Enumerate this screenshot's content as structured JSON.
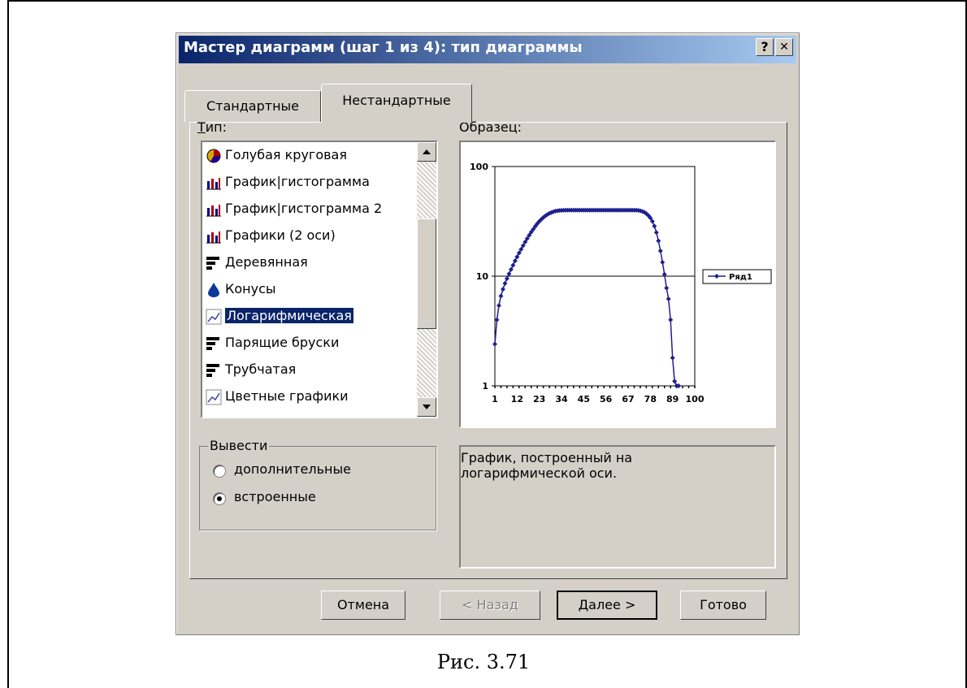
{
  "dialog": {
    "title": "Мастер диаграмм (шаг 1 из 4): тип диаграммы",
    "help_button": "?",
    "close_button": "✕",
    "tabs": [
      {
        "label": "Стандартные",
        "active": false
      },
      {
        "label": "Нестандартные",
        "active": true
      }
    ],
    "type_label": "Тип:",
    "sample_label": "Образец:",
    "chart_types": [
      {
        "label": "Голубая круговая",
        "icon": "pie-icon"
      },
      {
        "label": "График|гистограмма",
        "icon": "line-column-icon"
      },
      {
        "label": "График|гистограмма 2",
        "icon": "line-column-icon"
      },
      {
        "label": "Графики (2 оси)",
        "icon": "line-column-icon"
      },
      {
        "label": "Деревянная",
        "icon": "bar-icon"
      },
      {
        "label": "Конусы",
        "icon": "cone-icon"
      },
      {
        "label": "Логарифмическая",
        "icon": "log-line-icon",
        "selected": true
      },
      {
        "label": "Парящие бруски",
        "icon": "bar-icon"
      },
      {
        "label": "Трубчатая",
        "icon": "bar-icon"
      },
      {
        "label": "Цветные графики",
        "icon": "log-line-icon"
      }
    ],
    "output_group": {
      "title": "Вывести",
      "options": [
        {
          "label": "дополнительные",
          "checked": false
        },
        {
          "label": "встроенные",
          "checked": true
        }
      ]
    },
    "description": [
      "График, построенный на",
      "логарифмической оси."
    ],
    "buttons": {
      "cancel": "Отмена",
      "back": "< Назад",
      "next": "Далее >",
      "finish": "Готово"
    }
  },
  "caption": "Рис. 3.71",
  "chart_data": {
    "type": "line",
    "yscale": "log",
    "ylim": [
      1,
      100
    ],
    "y_ticks": [
      "1",
      "10",
      "100"
    ],
    "x_ticks": [
      "1",
      "12",
      "23",
      "34",
      "45",
      "56",
      "67",
      "78",
      "89",
      "100"
    ],
    "series": [
      {
        "name": "Ряд1",
        "color": "#1f1f8f",
        "x": [
          1,
          2,
          3,
          4,
          5,
          6,
          7,
          8,
          9,
          10,
          11,
          12,
          13,
          14,
          15,
          16,
          17,
          18,
          19,
          20,
          21,
          22,
          23,
          24,
          25,
          26,
          27,
          28,
          29,
          30,
          31,
          32,
          33,
          34,
          35,
          36,
          37,
          38,
          39,
          40,
          41,
          42,
          43,
          44,
          45,
          46,
          47,
          48,
          49,
          50,
          51,
          52,
          53,
          54,
          55,
          56,
          57,
          58,
          59,
          60,
          61,
          62,
          63,
          64,
          65,
          66,
          67,
          68,
          69,
          70,
          71,
          72,
          73,
          74,
          75,
          76,
          77,
          78,
          79,
          80,
          81,
          82,
          83,
          84,
          85,
          86,
          87,
          88,
          89,
          90,
          91,
          92
        ],
        "y": [
          2.4,
          4.0,
          5.4,
          6.6,
          7.6,
          8.6,
          9.5,
          10.5,
          11.5,
          12.6,
          13.8,
          15.0,
          16.3,
          17.6,
          19.0,
          20.5,
          22.0,
          23.6,
          25.2,
          26.8,
          28.5,
          30.1,
          31.6,
          33.0,
          34.3,
          35.5,
          36.5,
          37.4,
          38.1,
          38.7,
          39.2,
          39.5,
          39.7,
          39.8,
          39.9,
          40,
          40,
          40,
          40,
          40,
          40,
          40,
          40,
          40,
          40,
          40,
          40,
          40,
          40,
          40,
          40,
          40,
          40,
          40,
          40,
          40,
          40,
          40,
          40,
          40,
          40,
          40,
          40,
          40,
          40,
          40,
          40,
          40,
          40,
          40,
          40,
          39.8,
          39.5,
          39.0,
          38.3,
          37.2,
          35.8,
          34.0,
          31.6,
          28.6,
          25.0,
          21.0,
          17.0,
          13.4,
          10.4,
          7.8,
          6.2,
          4.0,
          1.8,
          1.1,
          1.0,
          1.0
        ]
      }
    ]
  }
}
